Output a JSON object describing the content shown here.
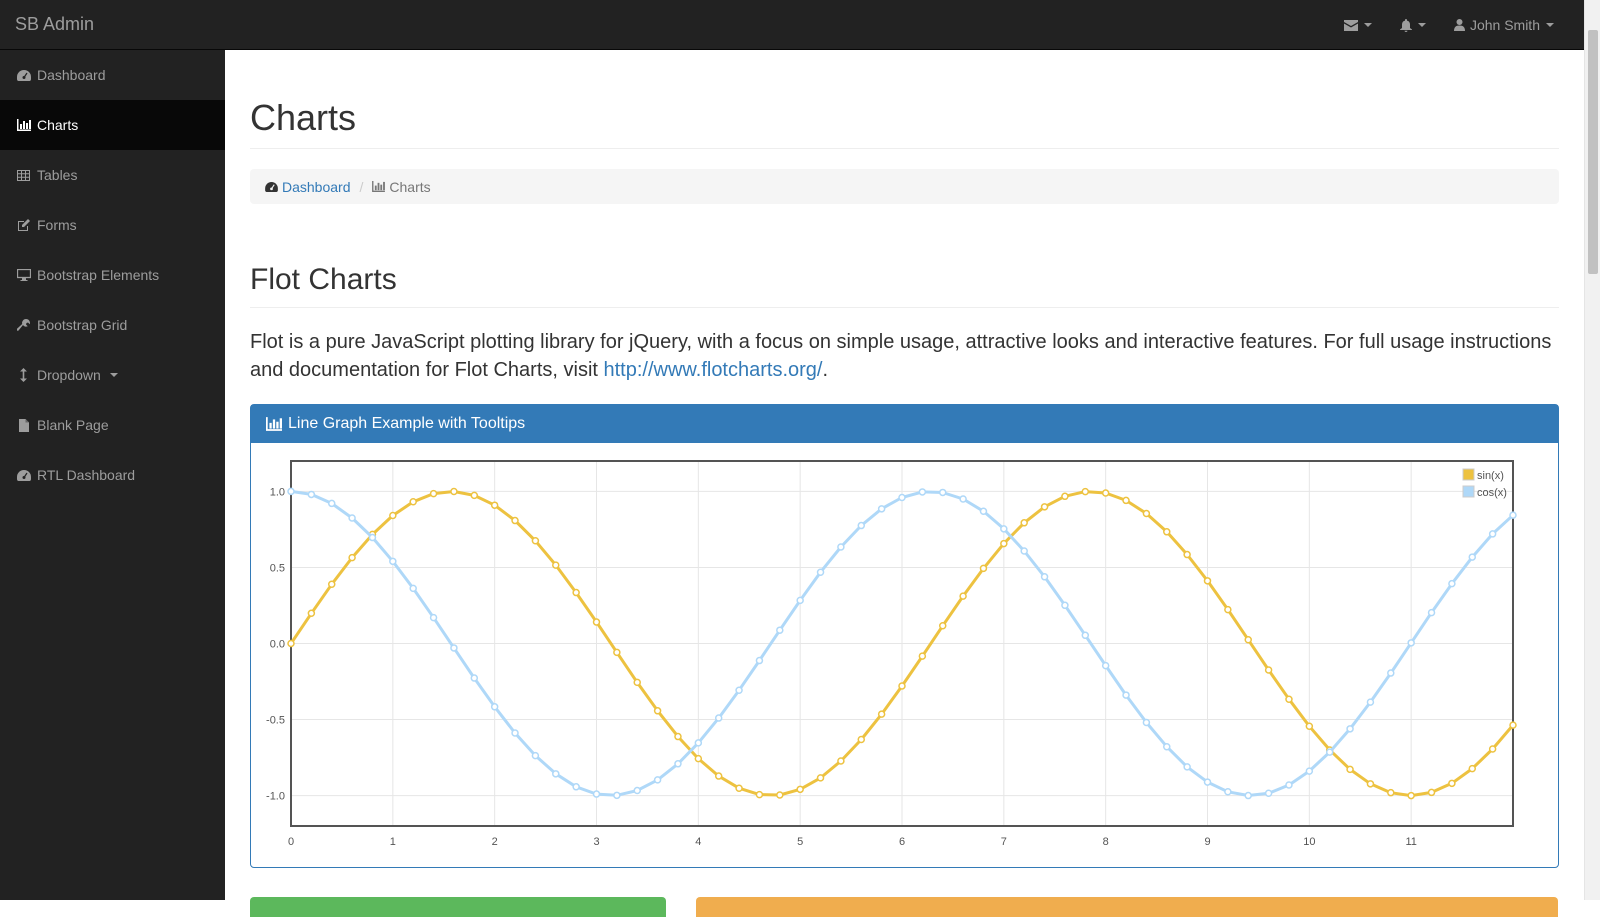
{
  "brand": "SB Admin",
  "top_right": {
    "messages_icon": "envelope-icon",
    "alerts_icon": "bell-icon",
    "user_name": "John Smith"
  },
  "sidebar": {
    "items": [
      {
        "label": "Dashboard",
        "icon": "dashboard-icon",
        "active": false
      },
      {
        "label": "Charts",
        "icon": "bar-chart-icon",
        "active": true
      },
      {
        "label": "Tables",
        "icon": "table-icon",
        "active": false
      },
      {
        "label": "Forms",
        "icon": "edit-icon",
        "active": false
      },
      {
        "label": "Bootstrap Elements",
        "icon": "desktop-icon",
        "active": false
      },
      {
        "label": "Bootstrap Grid",
        "icon": "wrench-icon",
        "active": false
      },
      {
        "label": "Dropdown",
        "icon": "arrows-v-icon",
        "active": false
      },
      {
        "label": "Blank Page",
        "icon": "file-icon",
        "active": false
      },
      {
        "label": "RTL Dashboard",
        "icon": "dashboard-icon",
        "active": false
      }
    ]
  },
  "page_title": "Charts",
  "breadcrumb": {
    "parent": "Dashboard",
    "current": "Charts"
  },
  "section_title": "Flot Charts",
  "lead": {
    "text": "Flot is a pure JavaScript plotting library for jQuery, with a focus on simple usage, attractive looks and interactive features. For full usage instructions and documentation for Flot Charts, visit ",
    "link": "http://www.flotcharts.org/",
    "after": "."
  },
  "panel_title": "Line Graph Example with Tooltips",
  "colors": {
    "sin": "#edc240",
    "cos": "#afd8f8",
    "panel": "#337ab7",
    "green": "#5cb85c",
    "orange": "#f0ad4e"
  },
  "chart_data": {
    "type": "line",
    "title": "",
    "xlabel": "",
    "ylabel": "",
    "xlim": [
      0,
      12
    ],
    "ylim": [
      -1.2,
      1.2
    ],
    "xticks": [
      "0",
      "1",
      "2",
      "3",
      "4",
      "5",
      "6",
      "7",
      "8",
      "9",
      "10",
      "11"
    ],
    "yticks": [
      "1.0",
      "0.5",
      "0.0",
      "-0.5",
      "-1.0"
    ],
    "grid": true,
    "legend": "top-right",
    "x_step": 0.2,
    "series": [
      {
        "name": "sin(x)",
        "function": "sin"
      },
      {
        "name": "cos(x)",
        "function": "cos"
      }
    ]
  }
}
